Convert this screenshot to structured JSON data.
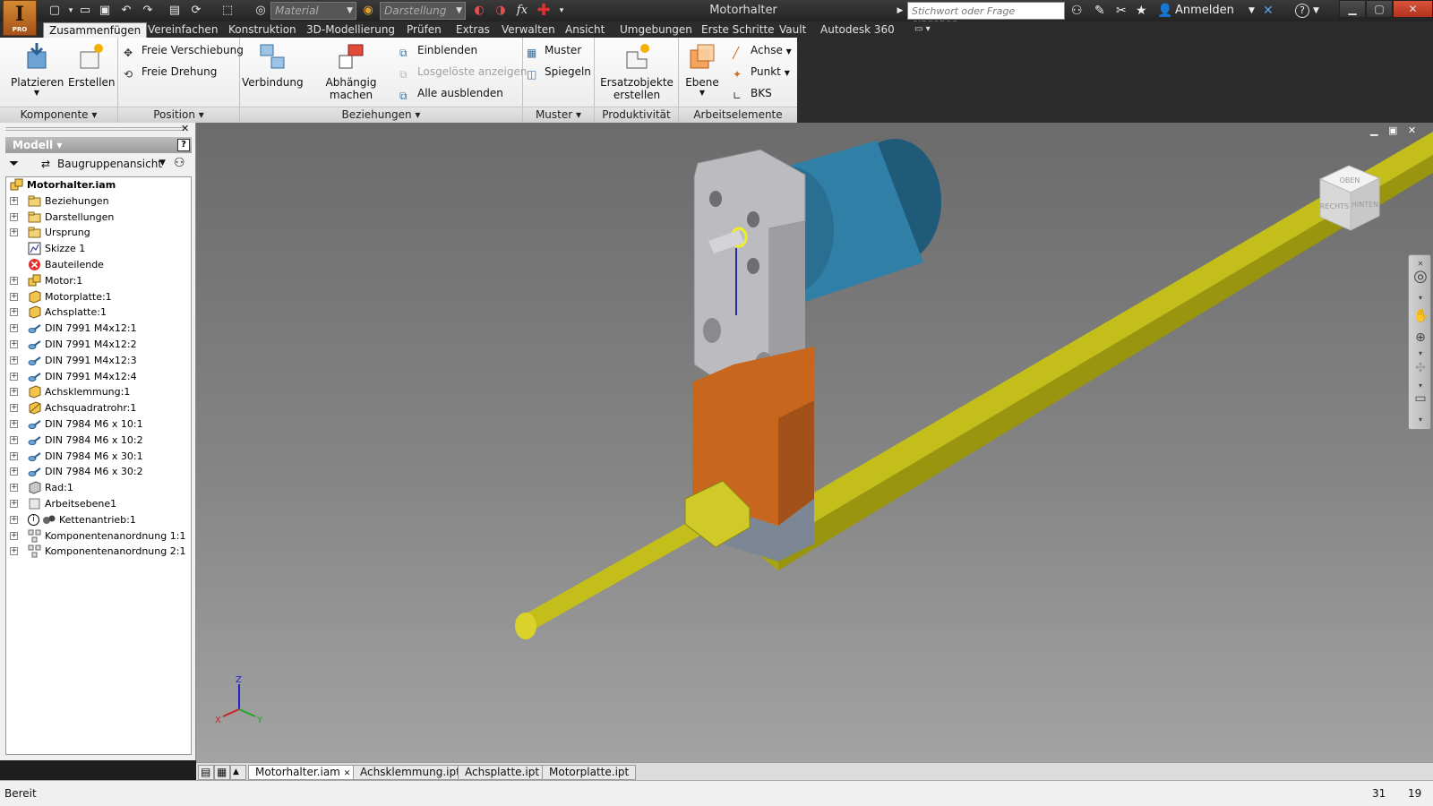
{
  "app": {
    "title": "Motorhalter",
    "logo_letter": "I",
    "logo_sub": "PRO"
  },
  "quick_access": {
    "material_placeholder": "Material",
    "appearance_placeholder": "Darstellung",
    "formula_symbol": "fx"
  },
  "help": {
    "search_placeholder": "Stichwort oder Frage eingeben",
    "sign_in": "Anmelden",
    "help_symbol": "?"
  },
  "ribbon_tabs": [
    {
      "label": "Zusammenfügen",
      "active": true
    },
    {
      "label": "Vereinfachen"
    },
    {
      "label": "Konstruktion"
    },
    {
      "label": "3D-Modellierung"
    },
    {
      "label": "Prüfen"
    },
    {
      "label": "Extras"
    },
    {
      "label": "Verwalten"
    },
    {
      "label": "Ansicht"
    },
    {
      "label": "Umgebungen"
    },
    {
      "label": "Erste Schritte"
    },
    {
      "label": "Vault"
    },
    {
      "label": "Autodesk 360"
    }
  ],
  "ribbon": {
    "komponente": {
      "title": "Komponente",
      "platzieren": "Platzieren",
      "erstellen": "Erstellen"
    },
    "position": {
      "title": "Position",
      "freie_verschiebung": "Freie Verschiebung",
      "freie_drehung": "Freie Drehung"
    },
    "beziehungen": {
      "title": "Beziehungen",
      "verbindung": "Verbindung",
      "abhaengig": "Abhängig machen",
      "einblenden": "Einblenden",
      "losgeloeste": "Losgelöste anzeigen",
      "alle_ausblenden": "Alle ausblenden"
    },
    "muster": {
      "title": "Muster",
      "muster": "Muster",
      "spiegeln": "Spiegeln"
    },
    "produktivitaet": {
      "title": "Produktivität",
      "ersatz_line1": "Ersatzobjekte",
      "ersatz_line2": "erstellen"
    },
    "arbeitselemente": {
      "title": "Arbeitselemente",
      "ebene": "Ebene",
      "achse": "Achse",
      "punkt": "Punkt",
      "bks": "BKS"
    }
  },
  "browser": {
    "header": "Modell",
    "view_mode": "Baugruppenansicht",
    "root": "Motorhalter.iam",
    "items": [
      {
        "label": "Beziehungen",
        "icon": "folder-icon"
      },
      {
        "label": "Darstellungen",
        "icon": "folder-icon"
      },
      {
        "label": "Ursprung",
        "icon": "folder-icon"
      },
      {
        "label": "Skizze 1",
        "icon": "sketch-icon"
      },
      {
        "label": "Bauteilende",
        "icon": "end-of-part-icon"
      },
      {
        "label": "Motor:1",
        "icon": "subassembly-icon"
      },
      {
        "label": "Motorplatte:1",
        "icon": "part-icon"
      },
      {
        "label": "Achsplatte:1",
        "icon": "part-icon"
      },
      {
        "label": "DIN 7991 M4x12:1",
        "icon": "fastener-icon"
      },
      {
        "label": "DIN 7991 M4x12:2",
        "icon": "fastener-icon"
      },
      {
        "label": "DIN 7991 M4x12:3",
        "icon": "fastener-icon"
      },
      {
        "label": "DIN 7991 M4x12:4",
        "icon": "fastener-icon"
      },
      {
        "label": "Achsklemmung:1",
        "icon": "part-icon"
      },
      {
        "label": "Achsquadratrohr:1",
        "icon": "frame-part-icon"
      },
      {
        "label": "DIN 7984 M6 x 10:1",
        "icon": "fastener-icon"
      },
      {
        "label": "DIN 7984 M6 x 10:2",
        "icon": "fastener-icon"
      },
      {
        "label": "DIN 7984 M6 x 30:1",
        "icon": "fastener-icon"
      },
      {
        "label": "DIN 7984 M6 x 30:2",
        "icon": "fastener-icon"
      },
      {
        "label": "Rad:1",
        "icon": "grey-part-icon"
      },
      {
        "label": "Arbeitsebene1",
        "icon": "work-plane-icon"
      },
      {
        "label": "Kettenantrieb:1",
        "icon": "chain-drive-icon"
      },
      {
        "label": "Komponentenanordnung 1:1",
        "icon": "pattern-icon"
      },
      {
        "label": "Komponentenanordnung 2:1",
        "icon": "pattern-icon"
      }
    ]
  },
  "viewcube": {
    "top": "OBEN",
    "left": "RECHTS",
    "right": "HINTEN"
  },
  "axes": {
    "x": "X",
    "y": "Y",
    "z": "Z"
  },
  "doc_tabs": [
    {
      "label": "Motorhalter.iam",
      "active": true
    },
    {
      "label": "Achsklemmung.ipt"
    },
    {
      "label": "Achsplatte.ipt"
    },
    {
      "label": "Motorplatte.ipt"
    }
  ],
  "status": {
    "text": "Bereit",
    "count_a": "31",
    "count_b": "19"
  },
  "colors": {
    "motor": "#2f7fa6",
    "bracket": "#c8661e",
    "shaft": "#c8c21e",
    "plate": "#b8b8bc"
  }
}
